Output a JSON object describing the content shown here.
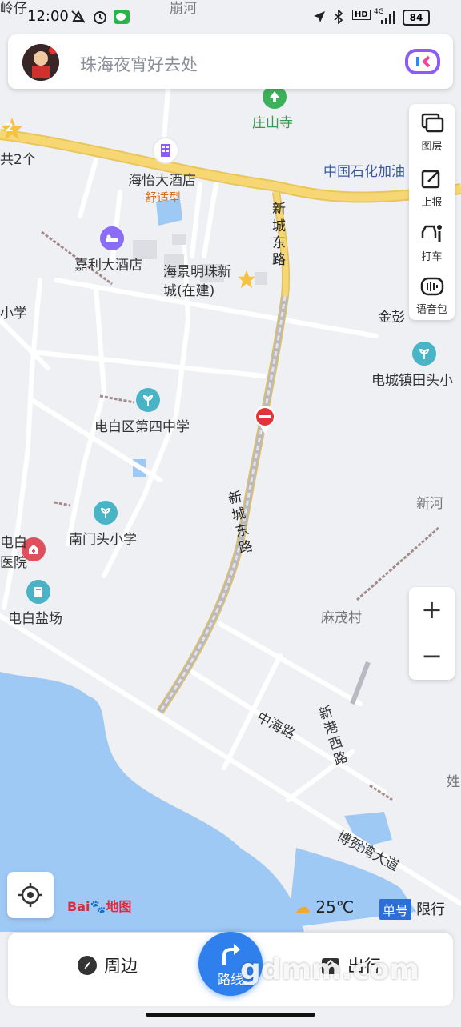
{
  "status_bar": {
    "time": "12:00",
    "battery": "84",
    "network": "4G",
    "hd_badge": "HD",
    "icons": [
      "mute-icon",
      "alarm-icon",
      "wechat-icon",
      "location-icon",
      "bluetooth-icon",
      "signal-icon",
      "battery-icon"
    ]
  },
  "search": {
    "placeholder": "珠海夜宵好去处"
  },
  "toolbar": {
    "layers": "图层",
    "report": "上报",
    "taxi": "打车",
    "voice_pack": "语音包"
  },
  "map": {
    "labels": {
      "top_road": "崩河",
      "top_left": "岭仔",
      "temple": "庄山寺",
      "star_count": "2",
      "star_label": "共2个",
      "hotel1": "海怡大酒店",
      "hotel1_tag": "舒适型",
      "gas_station": "中国石化加油",
      "xincheng_1": "新城东路",
      "hotel2": "嘉利大酒店",
      "estate": "海景明珠新城(在建)",
      "school_left": "小学",
      "jinpeng": "金彭",
      "dianchengzhen": "电城镇田头小",
      "school4": "电白区第四中学",
      "xincheng_2": "新城东路",
      "xinhe": "新河",
      "nanmentou": "南门头小学",
      "hospital_a": "电白",
      "hospital_b": "医院",
      "salt_field": "电白盐场",
      "mamaocun": "麻茂村",
      "zhonghai": "中海路",
      "xingang": "新港西路",
      "bohe": "博贺湾大道",
      "right_edge": "姓"
    }
  },
  "weather": {
    "temp": "25℃"
  },
  "restriction": {
    "badge": "单号",
    "label": "限行"
  },
  "logo": {
    "text": "Bai",
    "suffix": "地图"
  },
  "bottom": {
    "nearby": "周边",
    "route": "路线",
    "travel": "出行"
  },
  "watermark": "gdmm.com",
  "colors": {
    "main_road": "#f7d774",
    "water": "#9fc9f5",
    "route_blue": "#2f80ed",
    "green_poi": "#3db05c",
    "road_white": "#ffffff"
  }
}
